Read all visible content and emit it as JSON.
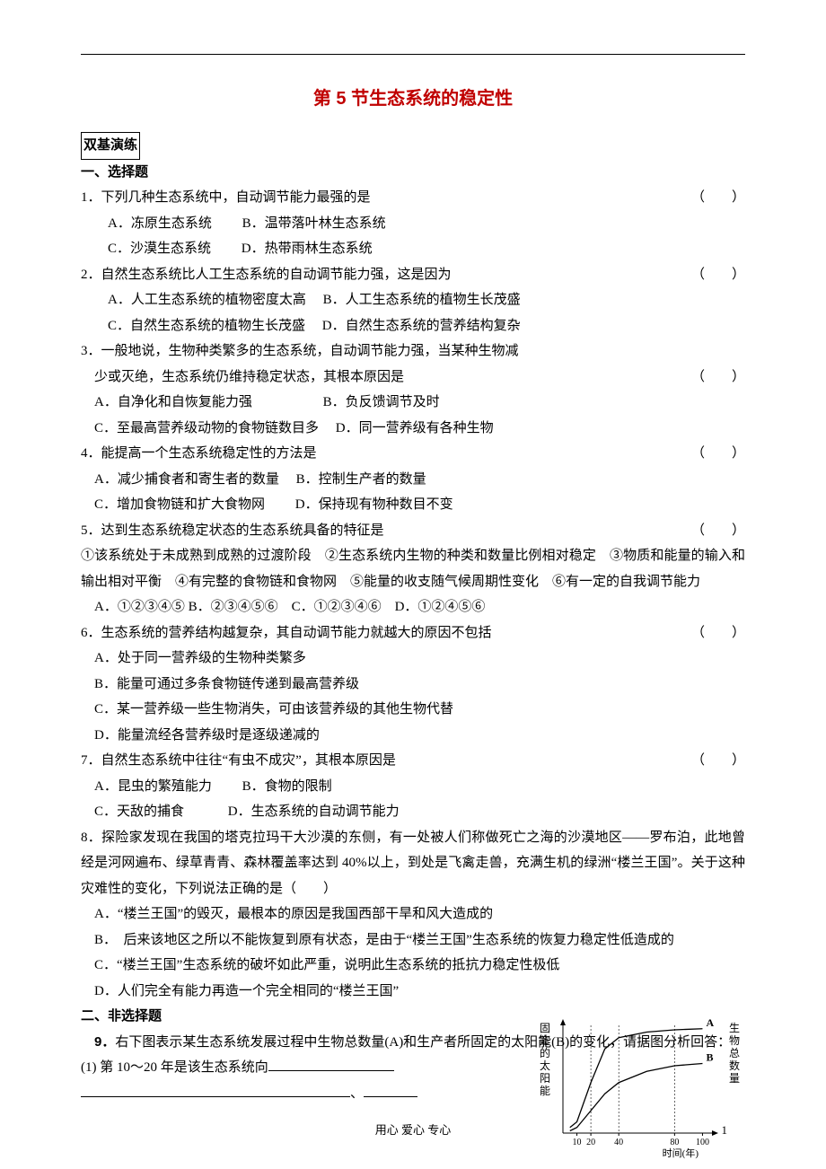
{
  "title": "第 5 节生态系统的稳定性",
  "section_label": "双基演练",
  "part1_heading": "一、选择题",
  "part2_heading": "二、非选择题",
  "paren_text": "（　　）",
  "questions": {
    "q1": {
      "stem": "1．下列几种生态系统中，自动调节能力最强的是",
      "optA": "A．冻原生态系统",
      "optB": "B．温带落叶林生态系统",
      "optC": "C．沙漠生态系统",
      "optD": "D．热带雨林生态系统"
    },
    "q2": {
      "stem": "2．自然生态系统比人工生态系统的自动调节能力强，这是因为",
      "optA": "A．人工生态系统的植物密度太高",
      "optB": "B．人工生态系统的植物生长茂盛",
      "optC": "C．自然生态系统的植物生长茂盛",
      "optD": "D．自然生态系统的营养结构复杂"
    },
    "q3": {
      "stem1": "3．一般地说，生物种类繁多的生态系统，自动调节能力强，当某种生物减",
      "stem2": "少或灭绝，生态系统仍维持稳定状态，其根本原因是",
      "optA": "A．自净化和自恢复能力强",
      "optB": "B．负反馈调节及时",
      "optC": "C．至最高营养级动物的食物链数目多",
      "optD": "D．同一营养级有各种生物"
    },
    "q4": {
      "stem": "4．能提高一个生态系统稳定性的方法是",
      "optA": "A．减少捕食者和寄生者的数量",
      "optB": "B．控制生产者的数量",
      "optC": "C．增加食物链和扩大食物网",
      "optD": "D．保持现有物种数目不变"
    },
    "q5": {
      "stem": "5．达到生态系统稳定状态的生态系统具备的特征是",
      "body": "①该系统处于未成熟到成熟的过渡阶段　②生态系统内生物的种类和数量比例相对稳定　③物质和能量的输入和输出相对平衡　④有完整的食物链和食物网　⑤能量的收支随气候周期性变化　⑥有一定的自我调节能力",
      "opts": "A．①②③④⑤ B．②③④⑤⑥　C．①②③④⑥　D．①②④⑤⑥"
    },
    "q6": {
      "stem": "6．生态系统的营养结构越复杂，其自动调节能力就越大的原因不包括",
      "optA": "A．处于同一营养级的生物种类繁多",
      "optB": "B．能量可通过多条食物链传递到最高营养级",
      "optC": "C．某一营养级一些生物消失，可由该营养级的其他生物代替",
      "optD": "D．能量流经各营养级时是逐级递减的"
    },
    "q7": {
      "stem": "7．自然生态系统中往往“有虫不成灾”，其根本原因是",
      "optA": "A．昆虫的繁殖能力",
      "optB": "B．食物的限制",
      "optC": "C．天敌的捕食",
      "optD": "D．生态系统的自动调节能力"
    },
    "q8": {
      "stem": "8．探险家发现在我国的塔克拉玛干大沙漠的东侧，有一处被人们称做死亡之海的沙漠地区——罗布泊，此地曾经是河网遍布、绿草青青、森林覆盖率达到 40%以上，到处是飞禽走兽，充满生机的绿洲“楼兰王国”。关于这种灾难性的变化，下列说法正确的是（　　）",
      "optA": "A．“楼兰王国”的毁灭，最根本的原因是我国西部干旱和风大造成的",
      "optB": "B．　后来该地区之所以不能恢复到原有状态，是由于“楼兰王国”生态系统的恢复力稳定性低造成的",
      "optC": "C．“楼兰王国”生态系统的破坏如此严重，说明此生态系统的抵抗力稳定性极低",
      "optD": "D．人们完全有能力再造一个完全相同的“楼兰王国”"
    },
    "q9": {
      "num": "9．",
      "stem": "右下图表示某生态系统发展过程中生物总数量(A)和生产者所固定的太阳能(B)的变化，请据图分析回答：",
      "sub1_pre": "(1) 第 10～20 年是该生态系统向",
      "sep": "、"
    }
  },
  "footer": "用心 爱心 专心",
  "pagenum": "1",
  "chart_data": {
    "type": "line",
    "xlabel": "时间(年)",
    "ylabel_left": "固定的太阳能",
    "ylabel_right": "生物总数量",
    "x_ticks": [
      10,
      20,
      40,
      80,
      100
    ],
    "xlim": [
      0,
      110
    ],
    "series": [
      {
        "name": "A",
        "points": [
          [
            5,
            5
          ],
          [
            10,
            10
          ],
          [
            20,
            45
          ],
          [
            30,
            75
          ],
          [
            40,
            85
          ],
          [
            60,
            90
          ],
          [
            80,
            92
          ],
          [
            100,
            93
          ]
        ]
      },
      {
        "name": "B",
        "points": [
          [
            5,
            2
          ],
          [
            10,
            5
          ],
          [
            20,
            20
          ],
          [
            30,
            35
          ],
          [
            40,
            45
          ],
          [
            60,
            55
          ],
          [
            80,
            60
          ],
          [
            100,
            62
          ]
        ]
      }
    ],
    "ylim": [
      0,
      100
    ]
  }
}
